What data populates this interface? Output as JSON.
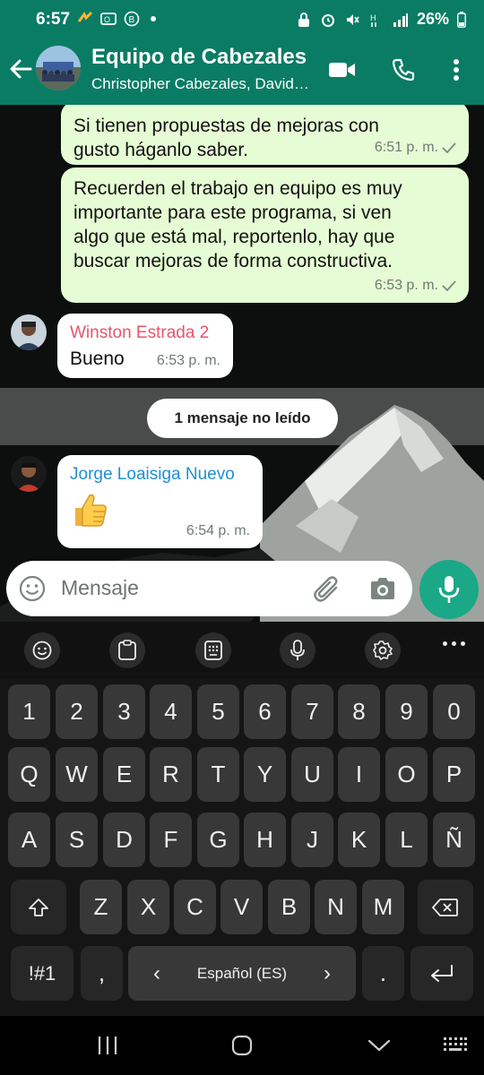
{
  "status_bar": {
    "time": "6:57",
    "battery": "26%"
  },
  "header": {
    "title": "Equipo de Cabezales",
    "subtitle": "Christopher Cabezales, David…"
  },
  "messages": [
    {
      "type": "outgoing",
      "text": "Si tienen propuestas de mejoras con gusto háganlo saber.",
      "line1": "Si tienen propuestas de mejoras con",
      "line2": "gusto háganlo saber.",
      "time": "6:51 p. m."
    },
    {
      "type": "outgoing",
      "lines": [
        "Recuerden el trabajo en equipo es muy",
        "importante para este programa, si ven",
        "algo que está mal, reportenlo, hay que",
        "buscar mejoras de forma constructiva."
      ],
      "time": "6:53 p. m."
    },
    {
      "type": "incoming",
      "sender": "Winston Estrada 2",
      "sender_color": "#e5566a",
      "text": "Bueno",
      "time": "6:53 p. m."
    },
    {
      "type": "incoming",
      "sender": "Jorge Loaisiga Nuevo",
      "sender_color": "#1f8fd6",
      "text": "👍",
      "time": "6:54 p. m."
    }
  ],
  "unread_banner": "1 mensaje no leído",
  "composer": {
    "placeholder": "Mensaje"
  },
  "keyboard": {
    "row_numbers": [
      "1",
      "2",
      "3",
      "4",
      "5",
      "6",
      "7",
      "8",
      "9",
      "0"
    ],
    "row_1": [
      "Q",
      "W",
      "E",
      "R",
      "T",
      "Y",
      "U",
      "I",
      "O",
      "P"
    ],
    "row_2": [
      "A",
      "S",
      "D",
      "F",
      "G",
      "H",
      "J",
      "K",
      "L",
      "Ñ"
    ],
    "row_3": [
      "Z",
      "X",
      "C",
      "V",
      "B",
      "N",
      "M"
    ],
    "symbols_key": "!#1",
    "comma_key": ",",
    "space_label": "Español (ES)",
    "period_key": ".",
    "space_left_arrow": "‹",
    "space_right_arrow": "›"
  },
  "colors": {
    "header": "#0a7c64",
    "accent": "#1aa886",
    "outgoing_bubble": "#e6fcd4"
  }
}
